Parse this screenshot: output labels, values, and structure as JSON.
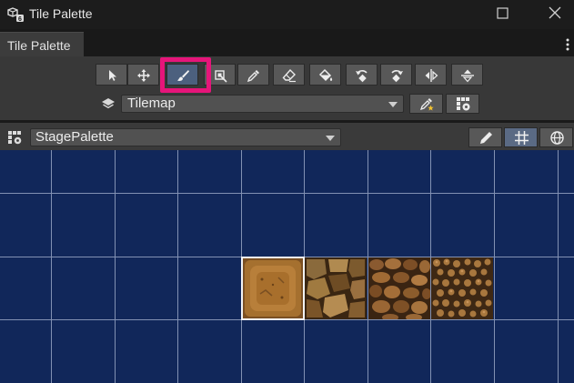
{
  "window": {
    "title": "Tile Palette"
  },
  "tab": {
    "label": "Tile Palette"
  },
  "toolbar": {
    "tools": [
      {
        "name": "select-tool-button",
        "icon": "arrow-pointer-icon"
      },
      {
        "name": "move-tool-button",
        "icon": "move-arrows-icon"
      },
      {
        "name": "paint-tool-button",
        "icon": "paintbrush-icon",
        "active": true
      },
      {
        "name": "box-fill-tool-button",
        "icon": "box-fill-icon"
      },
      {
        "name": "pick-tool-button",
        "icon": "eyedropper-icon"
      },
      {
        "name": "erase-tool-button",
        "icon": "eraser-icon"
      },
      {
        "name": "fill-tool-button",
        "icon": "paint-bucket-icon"
      },
      {
        "name": "rotate-ccw-button",
        "icon": "rotate-ccw-icon"
      },
      {
        "name": "rotate-cw-button",
        "icon": "rotate-cw-icon"
      },
      {
        "name": "flip-x-button",
        "icon": "flip-horizontal-icon"
      },
      {
        "name": "flip-y-button",
        "icon": "flip-vertical-icon"
      }
    ],
    "highlight_color": "#e6157a"
  },
  "target": {
    "label": "Tilemap"
  },
  "palette": {
    "label": "StagePalette"
  },
  "colors": {
    "grid_background": "#11275a",
    "grid_lines": "#8291b3",
    "active_tool": "#4c607e"
  }
}
